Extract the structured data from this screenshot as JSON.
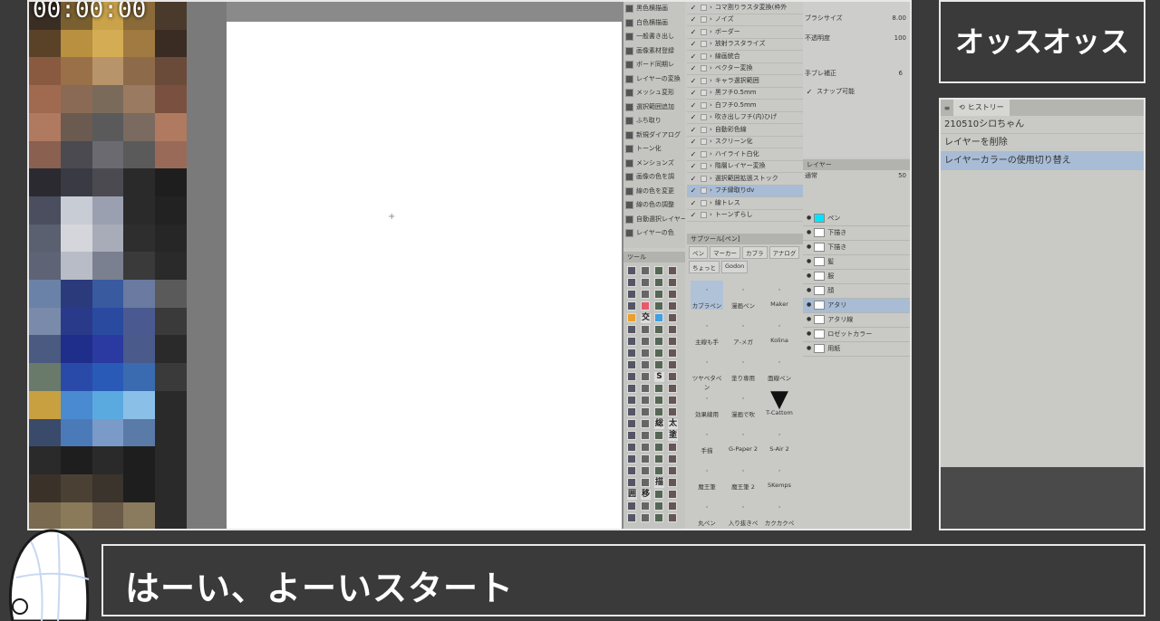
{
  "timer": "00:00:00",
  "stream_title": "オッスオッス",
  "subtitle": "はーい、よーいスタート",
  "history": {
    "tab_label": "ヒストリー",
    "items": [
      "210510シロちゃん",
      "レイヤーを削除",
      "レイヤーカラーの使用切り替え"
    ],
    "selected_index": 2
  },
  "csp": {
    "commands": [
      "黒色横描画",
      "白色横描画",
      "一般書き出し",
      "画像素材登録",
      "ボード同期レ",
      "レイヤーの変換",
      "メッシュ変形",
      "選択範囲追加",
      "ふち取り",
      "新規ダイアログ",
      "トーン化",
      "メンションズ",
      "画像の色を調",
      "線の色を変更",
      "線の色の調整",
      "自動選択レイヤー",
      "レイヤーの色"
    ],
    "auto_actions": [
      "コマ割りラスタ変換(枠外",
      "ノイズ",
      "ボーダー",
      "放射ラスタライズ",
      "線画統合",
      "ベクター変換",
      "キャラ選択範囲",
      "黒フチ0.5mm",
      "白フチ0.5mm",
      "吹き出しフチ(内)ひげ",
      "自動彩色線",
      "スクリーン化",
      "ハイライト白化",
      "階層レイヤー変換",
      "選択範囲拡張ストック",
      "フチ縁取りdv",
      "線トレス",
      "トーンずらし"
    ],
    "tool_property": {
      "brush_size_label": "ブラシサイズ",
      "brush_size_value": "8.00",
      "opacity_label": "不透明度",
      "opacity_value": "100",
      "stabilization_label": "手ブレ補正",
      "stabilization_value": "6",
      "snap_label": "スナップ可能"
    },
    "layer_panel": {
      "tab_label": "レイヤー",
      "blend_mode": "通常",
      "opacity": "50",
      "layers": [
        "ペン",
        "下描き",
        "下描き",
        "髪",
        "服",
        "顔",
        "アタリ",
        "アタリ線",
        "ロゼットカラー",
        "用紙"
      ],
      "selected_index": 6
    },
    "sub_tool_panel": {
      "tab_label": "サブツール[ペン]",
      "tabs": [
        "ペン",
        "マーカー",
        "カブラ",
        "アナログ",
        "ちょっと",
        "Godon"
      ],
      "brushes": [
        "カブラペン",
        "漫画ペン",
        "Maker",
        "主線も手",
        "ア-メガ",
        "Kolina",
        "ツヤベタペン",
        "塗り専用",
        "面線ペン",
        "効果線用",
        "漫画で吹",
        "T-Cattom",
        "手描",
        "G-Paper 2",
        "S-Air 2",
        "魔王筆",
        "魔王筆 2",
        "SKemps",
        "丸ペン",
        "入り抜きペン",
        "カクカクペン"
      ]
    },
    "tool_panel_label": "ツール",
    "tool_glyphs": [
      "交",
      "総",
      "太",
      "塗",
      "囲",
      "描",
      "移",
      "S"
    ]
  },
  "colors": {
    "panel_bg": "#c9cac6",
    "selection": "#a8bcd6",
    "frame_border": "#e8e8e8",
    "overlay_bg": "#3a3a3a",
    "cyan_highlight": "#00e5ff",
    "red_record": "#d9263a"
  },
  "icons": [
    "timer",
    "pixelated-webcam",
    "history-icon",
    "layer-eye-icon",
    "avatar-character"
  ]
}
